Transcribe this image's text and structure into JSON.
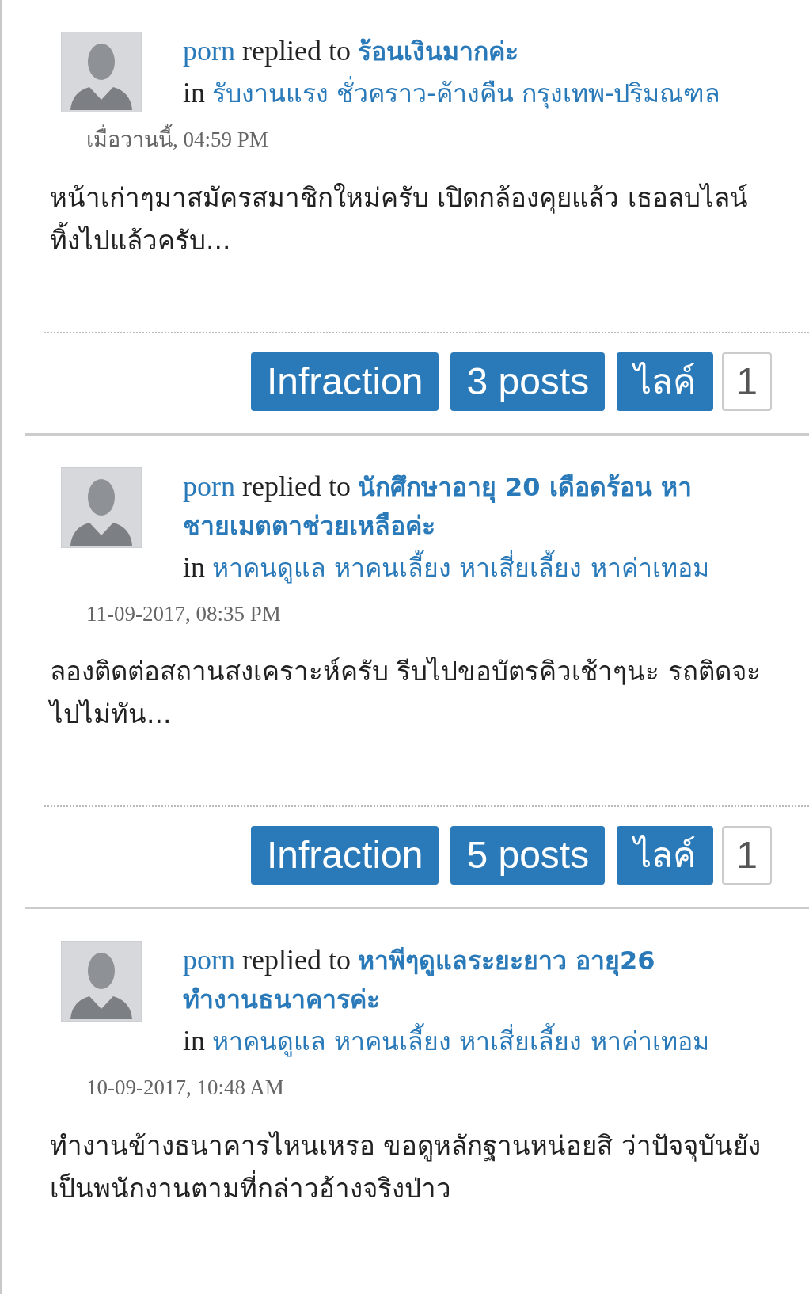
{
  "activity": [
    {
      "user": "porn",
      "action": "replied to",
      "thread": "ร้อนเงินมากค่ะ",
      "in_label": "in",
      "forum": "รับงานแรง ชั่วคราว-ค้างคืน กรุงเทพ-ปริมณฑล",
      "time": "เมื่อวานนี้, 04:59 PM",
      "snippet": "หน้าเก่าๆมาสมัครสมาชิกใหม่ครับ เปิดกล้องคุยแล้ว เธอลบไลน์ทิ้งไปแล้วครับ...",
      "buttons": {
        "infraction": "Infraction",
        "posts": "3 posts",
        "like": "ไลค์",
        "like_count": "1"
      }
    },
    {
      "user": "porn",
      "action": "replied to",
      "thread": "นักศึกษาอายุ 20 เดือดร้อน หา",
      "thread_line2": "ชายเมตตาช่วยเหลือค่ะ",
      "in_label": "in",
      "forum": "หาคนดูแล หาคนเลี้ยง หาเสี่ยเลี้ยง หาค่าเทอม",
      "time": "11-09-2017, 08:35 PM",
      "snippet": "ลองติดต่อสถานสงเคราะห์ครับ รีบไปขอบัตรคิวเช้าๆนะ รถติดจะไปไม่ทัน...",
      "buttons": {
        "infraction": "Infraction",
        "posts": "5 posts",
        "like": "ไลค์",
        "like_count": "1"
      }
    },
    {
      "user": "porn",
      "action": "replied to",
      "thread": "หาพีๆดูแลระยะยาว อายุ26",
      "thread_line2": "ทำงานธนาคารค่ะ",
      "in_label": "in",
      "forum": "หาคนดูแล หาคนเลี้ยง หาเสี่ยเลี้ยง หาค่าเทอม",
      "time": "10-09-2017, 10:48 AM",
      "snippet": "ทำงานข้างธนาคารไหนเหรอ ขอดูหลักฐานหน่อยสิ ว่าปัจจุบันยังเป็นพนักงานตามที่กล่าวอ้างจริงป่าว"
    }
  ]
}
